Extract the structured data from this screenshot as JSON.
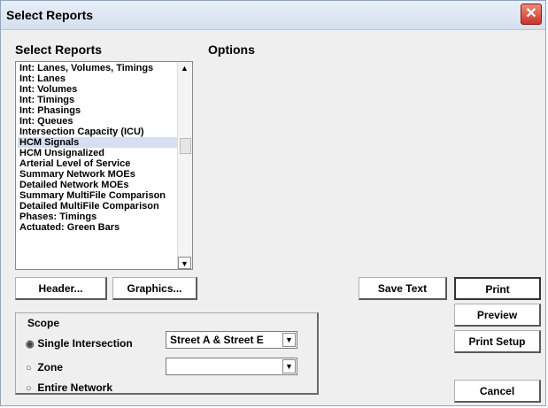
{
  "window": {
    "title": "Select Reports",
    "close_glyph": "✕"
  },
  "left_header": "Select Reports",
  "options_header": "Options",
  "report_list": {
    "items": [
      "Int: Lanes, Volumes, Timings",
      "Int: Lanes",
      "Int: Volumes",
      "Int: Timings",
      "Int: Phasings",
      "Int: Queues",
      "Intersection Capacity (ICU)",
      "HCM Signals",
      "HCM Unsignalized",
      "Arterial Level of Service",
      "Summary Network MOEs",
      "Detailed Network MOEs",
      "Summary MultiFile Comparison",
      "Detailed MultiFile Comparison",
      "Phases: Timings",
      "Actuated: Green Bars"
    ],
    "selected": "HCM Signals",
    "scroll_up_glyph": "▲",
    "scroll_down_glyph": "▼"
  },
  "buttons": {
    "header": "Header...",
    "graphics": "Graphics...",
    "save_text": "Save Text",
    "print": "Print",
    "preview": "Preview",
    "print_setup": "Print Setup",
    "cancel": "Cancel"
  },
  "scope": {
    "label": "Scope",
    "options": [
      "Single Intersection",
      "Zone",
      "Entire Network"
    ],
    "selected": "Single Intersection",
    "intersection_value": "Street A & Street E",
    "zone_value": ""
  }
}
